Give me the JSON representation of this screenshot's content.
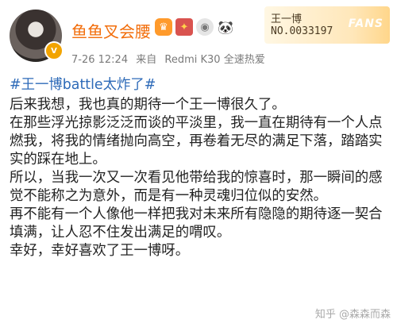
{
  "post": {
    "username": "鱼鱼叉会腰",
    "time": "7-26 12:24",
    "source_prefix": "来自",
    "source_device": "Redmi K30 全速热爱",
    "fan_card": {
      "name": "王一博",
      "number": "NO.0033197",
      "label": "FANS"
    },
    "topic": "#王一博battle太炸了#",
    "paragraphs": [
      "后来我想，我也真的期待一个王一博很久了。",
      "在那些浮光掠影泛泛而谈的平淡里，我一直在期待有一个人点燃我，将我的情绪抛向高空，再卷着无尽的满足下落，踏踏实实的踩在地上。",
      "所以，当我一次又一次看见他带给我的惊喜时，那一瞬间的感觉不能称之为意外，而是有一种灵魂归位似的安然。",
      "再不能有一个人像他一样把我对未来所有隐隐的期待逐一契合填满，让人忍不住发出满足的喟叹。",
      "幸好，幸好喜欢了王一博呀。"
    ]
  },
  "icons": {
    "avatar": "avatar-image",
    "vip_badge": "vip-badge-icon",
    "user_badges": [
      "crown-badge-icon",
      "award-badge-icon",
      "medal-badge-icon",
      "panda-badge-icon"
    ]
  },
  "watermark": "知乎 @森森而森"
}
